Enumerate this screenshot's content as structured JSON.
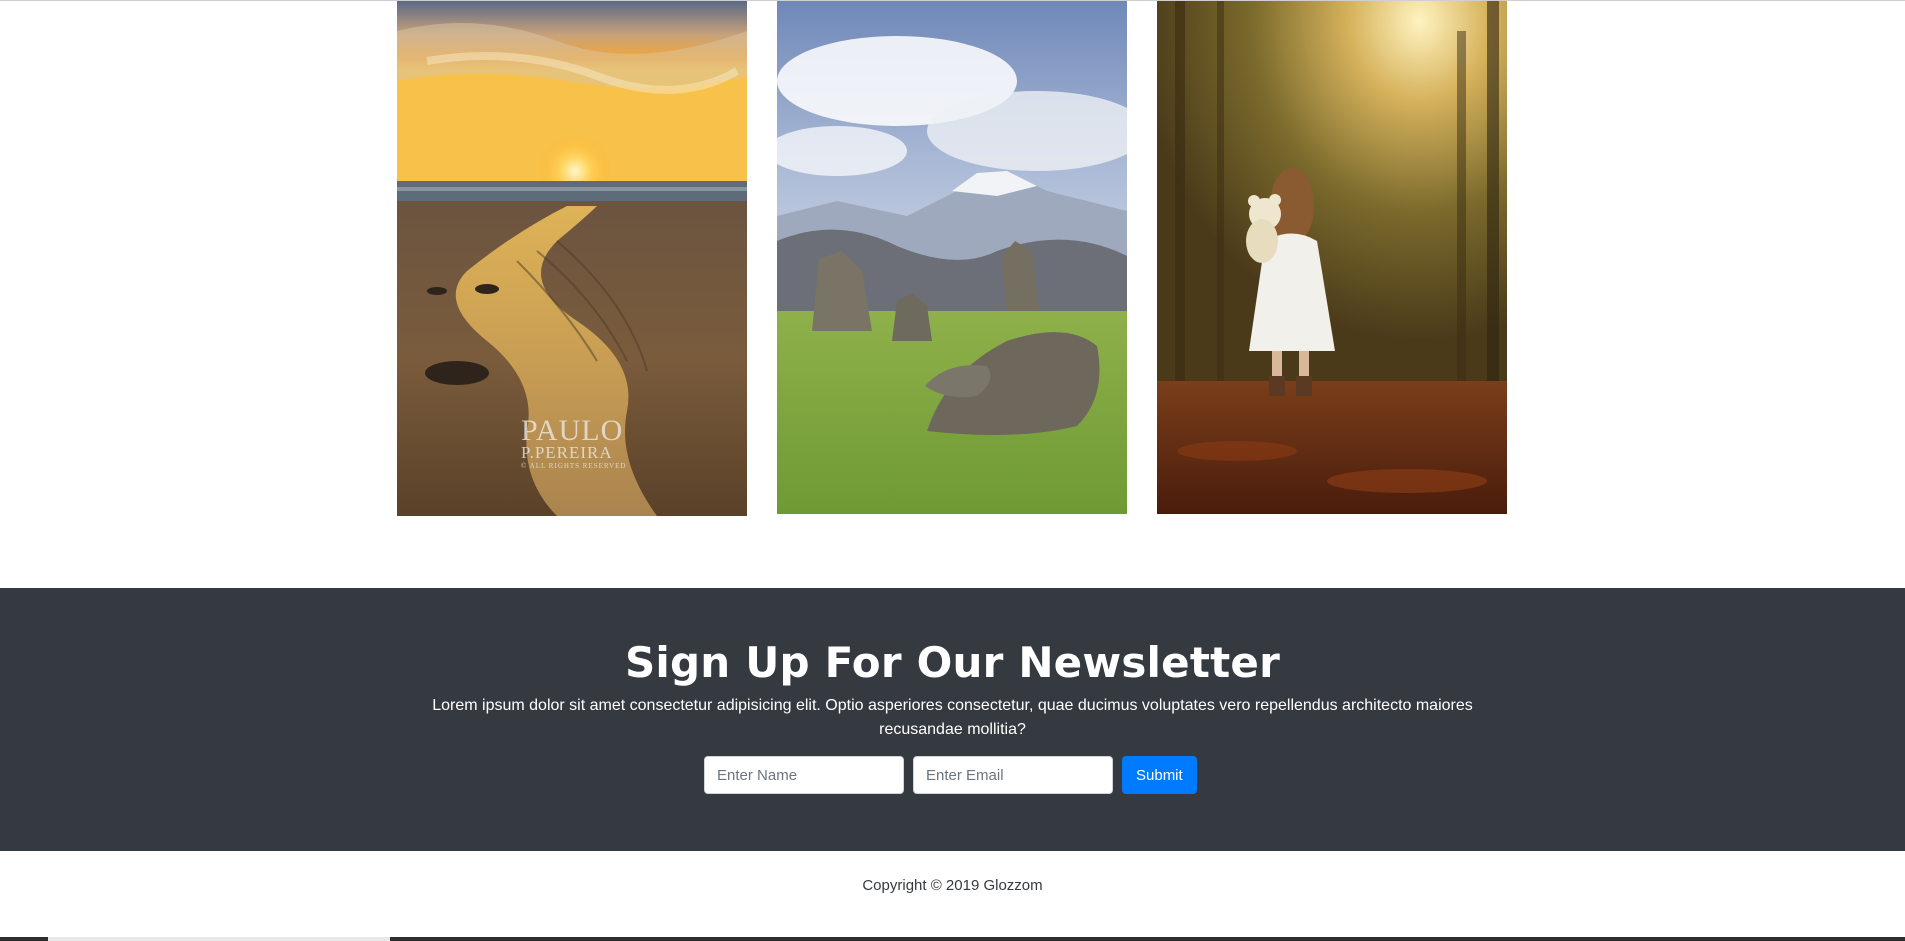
{
  "gallery": {
    "images": [
      {
        "description": "sunset-beach-photo",
        "watermark": {
          "main": "PAULO",
          "sub": "P.PEREIRA",
          "small": "© ALL RIGHTS RESERVED"
        }
      },
      {
        "description": "stone-circle-mountains-photo"
      },
      {
        "description": "girl-with-teddy-bear-forest-photo"
      }
    ]
  },
  "newsletter": {
    "title": "Sign Up For Our Newsletter",
    "text": "Lorem ipsum dolor sit amet consectetur adipisicing elit. Optio asperiores consectetur, quae ducimus voluptates vero repellendus architecto maiores recusandae mollitia?",
    "name_placeholder": "Enter Name",
    "email_placeholder": "Enter Email",
    "submit_label": "Submit",
    "colors": {
      "background": "#343a40",
      "button": "#007bff"
    }
  },
  "footer": {
    "copyright": "Copyright © 2019 Glozzom"
  }
}
